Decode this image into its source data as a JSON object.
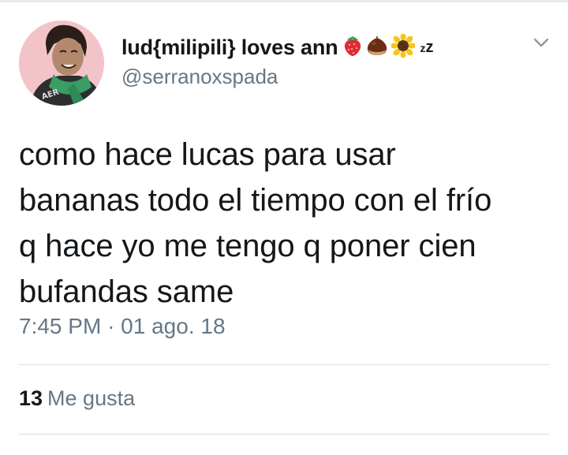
{
  "user": {
    "display_name": "lud{milipili} loves ann",
    "handle": "@serranoxspada",
    "name_emojis": [
      "strawberry-icon",
      "chestnut-icon",
      "sunflower-icon",
      "zzz-icon"
    ]
  },
  "tweet": {
    "text_lines": [
      "como hace lucas para usar",
      "bananas todo el tiempo con el frío",
      "q hace yo me tengo q poner cien",
      "bufandas same"
    ],
    "time": "7:45 PM",
    "separator": "·",
    "date": "01 ago. 18"
  },
  "stats": {
    "likes_count": "13",
    "likes_label": "Me gusta"
  },
  "colors": {
    "text_primary": "#14171a",
    "text_secondary": "#657786",
    "divider": "#d7dde2",
    "avatar_bg": "#f7c9cf"
  }
}
